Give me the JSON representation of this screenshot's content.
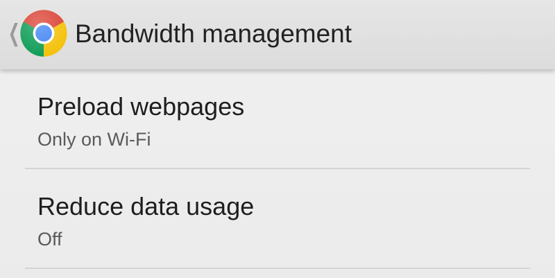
{
  "action_bar": {
    "title": "Bandwidth management",
    "back_icon": "chevron-left-icon",
    "app_icon": "chrome-logo-icon"
  },
  "preferences": [
    {
      "title": "Preload webpages",
      "summary": "Only on Wi-Fi"
    },
    {
      "title": "Reduce data usage",
      "summary": "Off"
    }
  ],
  "colors": {
    "background": "#eeeeee",
    "action_bar": "#e0e0e0",
    "title_text": "#222222",
    "summary_text": "#5a5a5a",
    "divider": "#d4d4d4",
    "chrome_red": "#db4437",
    "chrome_yellow": "#f4c20d",
    "chrome_green": "#0f9d58",
    "chrome_blue": "#4285f4"
  }
}
